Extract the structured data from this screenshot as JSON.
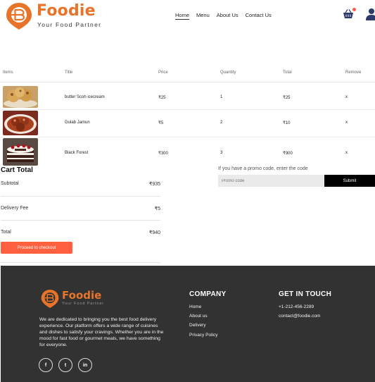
{
  "brand": {
    "name": "Foodie",
    "tagline": "Your Food Partner"
  },
  "nav": {
    "items": [
      "Home",
      "Menu",
      "About Us",
      "Contact Us"
    ],
    "active": "Home"
  },
  "cart": {
    "columns": [
      "Items",
      "Title",
      "Price",
      "Quantity",
      "Total",
      "Remove"
    ],
    "rows": [
      {
        "image": "butter-scotch-icecream-photo",
        "title": "butter Scoh icecream",
        "price": "₹25",
        "quantity": "1",
        "total": "₹25",
        "remove": "x"
      },
      {
        "image": "gulab-jamun-photo",
        "title": "Gulab Jamun",
        "price": "₹5",
        "quantity": "2",
        "total": "₹10",
        "remove": "x"
      },
      {
        "image": "black-forest-cake-photo",
        "title": "Black Forest",
        "price": "₹300",
        "quantity": "3",
        "total": "₹900",
        "remove": "x"
      }
    ]
  },
  "totals": {
    "title": "Cart Total",
    "subtotal_label": "Subtotal",
    "subtotal": "₹935",
    "delivery_label": "Delivery Fee",
    "delivery": "₹5",
    "total_label": "Total",
    "total": "₹940",
    "checkout_label": "Proceed to checkout"
  },
  "promo": {
    "label": "If you have a promo code, enter the code",
    "placeholder": "Promo code",
    "submit_label": "Submit"
  },
  "footer": {
    "about": "We are dedicated to bringing you the best food delivery experience. Our platform offers a wide range of cuisines and dishes to satisfy your cravings. Whether you are in the mood for fast food or gourmet meals, we have something for everyone.",
    "social": [
      "f",
      "t",
      "in"
    ],
    "company": {
      "title": "COMPANY",
      "links": [
        "Home",
        "About us",
        "Delivery",
        "Privacy Policy"
      ]
    },
    "contact": {
      "title": "GET IN TOUCH",
      "phone": "+1-212-456-2289",
      "email": "contact@foodie.com"
    }
  },
  "colors": {
    "brand_orange": "#e8742a",
    "checkout_button": "#ff6140",
    "footer_bg": "#323232",
    "cart_dot": "#ff5a4e"
  }
}
